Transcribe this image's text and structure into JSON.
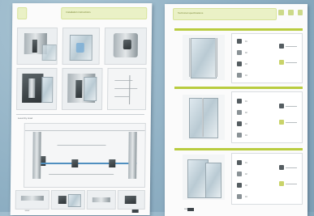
{
  "left_page": {
    "header_text": "Installation instructions",
    "detail_caption": "Assembly detail",
    "footer_text": "www"
  },
  "right_page": {
    "header_text": "Technical specifications",
    "sections": [
      {
        "rows": [
          "01",
          "02",
          "03",
          "04"
        ]
      },
      {
        "rows": [
          "01",
          "02",
          "03",
          "04"
        ]
      },
      {
        "rows": [
          "01",
          "02",
          "03",
          "04"
        ]
      }
    ],
    "footer_text": "www"
  },
  "colors": {
    "accent": "#b9cc3f",
    "header_bg": "#eaf1c6",
    "background": "#8fb0c4"
  }
}
